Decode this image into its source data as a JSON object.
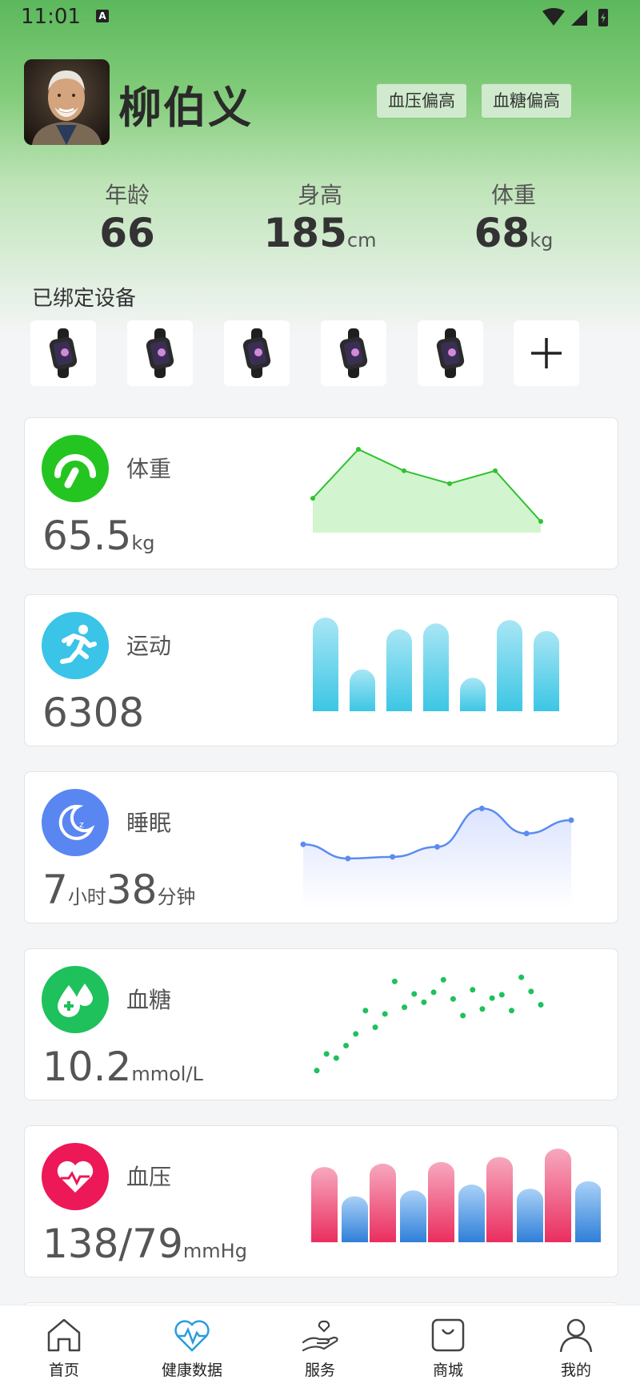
{
  "status_bar": {
    "time": "11:01",
    "app_badge": "A"
  },
  "profile": {
    "name": "柳伯义",
    "tags": [
      "血压偏高",
      "血糖偏高"
    ],
    "stats": [
      {
        "label": "年龄",
        "value": "66",
        "unit": ""
      },
      {
        "label": "身高",
        "value": "185",
        "unit": "cm"
      },
      {
        "label": "体重",
        "value": "68",
        "unit": "kg"
      }
    ]
  },
  "devices": {
    "title": "已绑定设备",
    "count": 5,
    "add_label": "+"
  },
  "cards": {
    "weight": {
      "title": "体重",
      "value": "65.5",
      "unit": "kg"
    },
    "exercise": {
      "title": "运动",
      "value": "6308"
    },
    "sleep": {
      "title": "睡眠",
      "hours": "7",
      "hours_unit": "小时",
      "minutes": "38",
      "minutes_unit": "分钟"
    },
    "glucose": {
      "title": "血糖",
      "value": "10.2",
      "unit": "mmol/L"
    },
    "pressure": {
      "title": "血压",
      "value": "138/79",
      "unit": "mmHg"
    }
  },
  "chart_data": [
    {
      "type": "area",
      "name": "weight",
      "values": [
        40,
        97,
        72,
        57,
        72,
        13
      ],
      "ylim": [
        0,
        110
      ],
      "color": "#2fc22f"
    },
    {
      "type": "bar",
      "name": "exercise",
      "values": [
        112,
        50,
        98,
        105,
        40,
        109,
        96
      ],
      "ylim": [
        0,
        115
      ],
      "color": "#4ccbe6"
    },
    {
      "type": "area",
      "name": "sleep",
      "values": [
        67,
        50,
        52,
        64,
        110,
        80,
        96
      ],
      "ylim": [
        0,
        120
      ],
      "color": "#5b8cf0"
    },
    {
      "type": "scatter",
      "name": "glucose",
      "points": [
        [
          0,
          8
        ],
        [
          1,
          28
        ],
        [
          2,
          23
        ],
        [
          3,
          38
        ],
        [
          4,
          52
        ],
        [
          5,
          80
        ],
        [
          6,
          60
        ],
        [
          7,
          76
        ],
        [
          8,
          115
        ],
        [
          9,
          84
        ],
        [
          10,
          100
        ],
        [
          11,
          90
        ],
        [
          12,
          102
        ],
        [
          13,
          117
        ],
        [
          14,
          94
        ],
        [
          15,
          74
        ],
        [
          16,
          105
        ],
        [
          17,
          82
        ],
        [
          18,
          95
        ],
        [
          19,
          99
        ],
        [
          20,
          80
        ],
        [
          21,
          120
        ],
        [
          22,
          103
        ],
        [
          23,
          87
        ]
      ],
      "color": "#1ec15c"
    },
    {
      "type": "bar",
      "name": "pressure",
      "series": [
        {
          "values": [
            90,
            94,
            96,
            102,
            112
          ]
        },
        {
          "values": [
            55,
            62,
            69,
            64,
            73
          ]
        }
      ],
      "ylim": [
        0,
        115
      ],
      "colors": [
        "#ef3f6a",
        "#3f8fe0"
      ]
    }
  ],
  "nav": {
    "active": 1,
    "items": [
      {
        "label": "首页",
        "icon": "home-icon"
      },
      {
        "label": "健康数据",
        "icon": "heart-pulse-icon"
      },
      {
        "label": "服务",
        "icon": "hand-heart-icon"
      },
      {
        "label": "商城",
        "icon": "shopping-bag-icon"
      },
      {
        "label": "我的",
        "icon": "user-icon"
      }
    ]
  },
  "colors": {
    "accent": "#2fc22f",
    "nav_active": "#2a9be0"
  }
}
